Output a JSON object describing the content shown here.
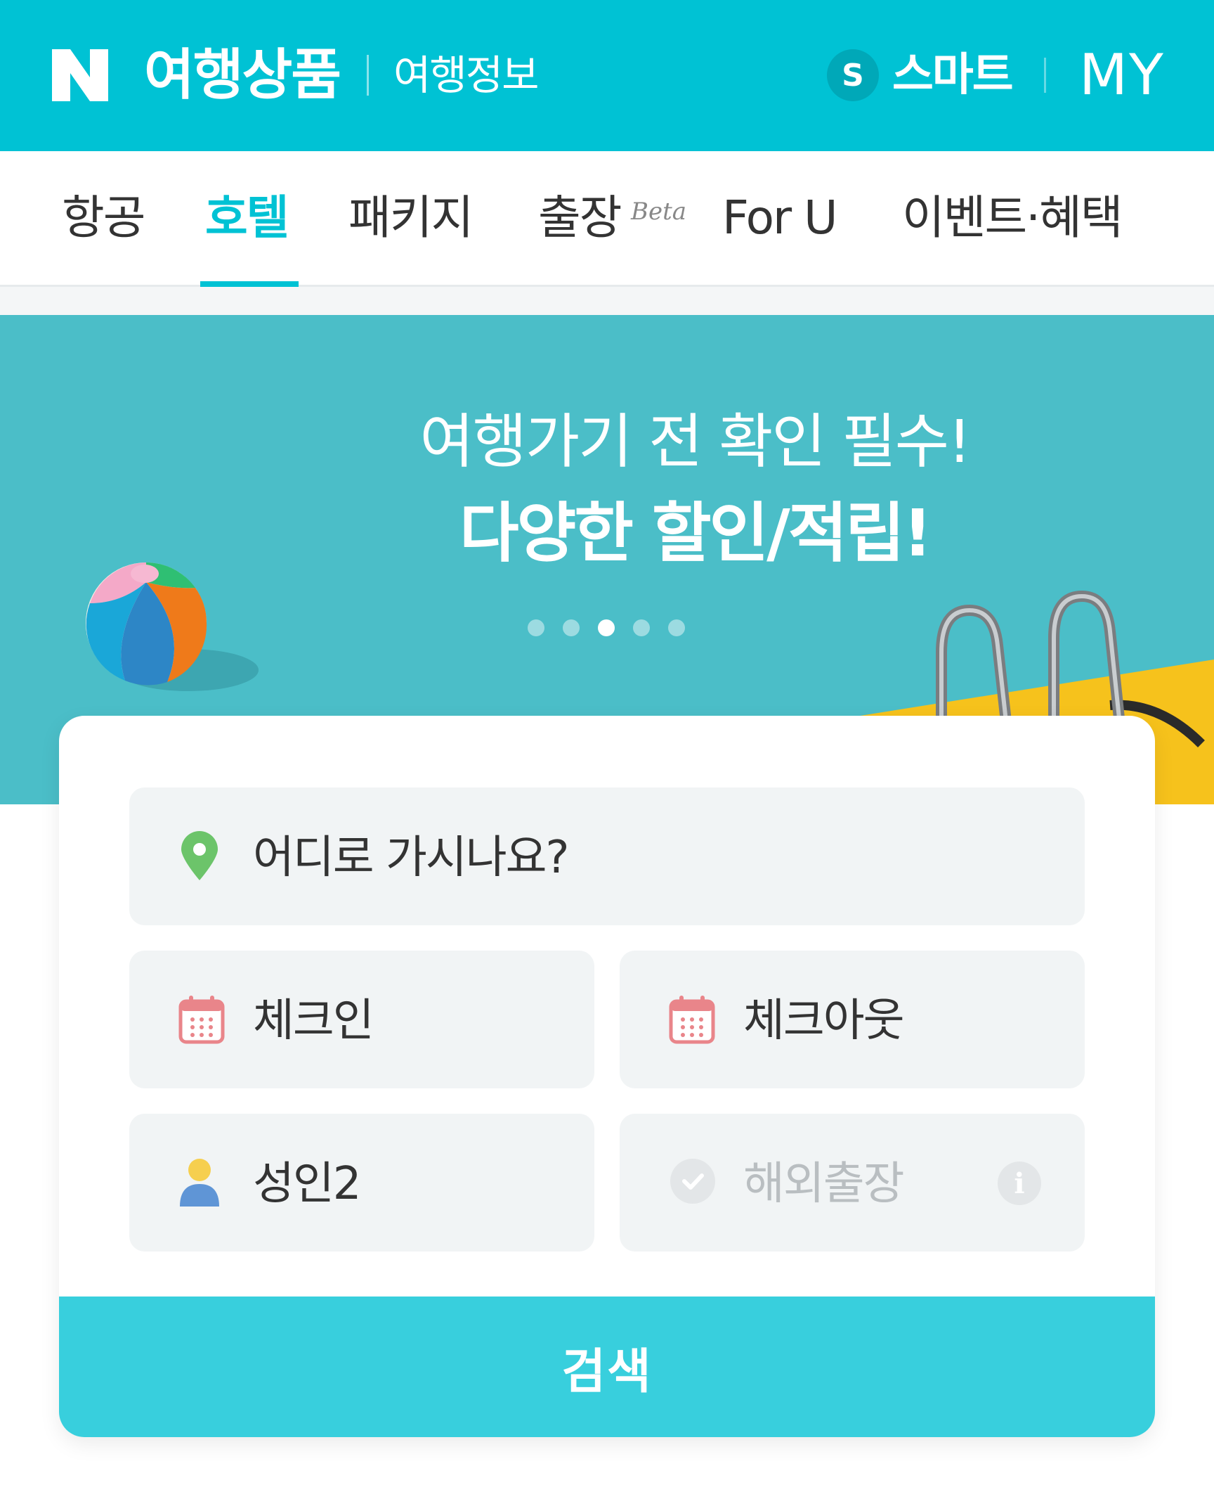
{
  "header": {
    "brand": "여행상품",
    "sub": "여행정보",
    "smart_badge": "S",
    "smart_label": "스마트",
    "my": "MY",
    "color": "#00c2d4"
  },
  "nav": {
    "tabs": [
      {
        "label": "항공"
      },
      {
        "label": "호텔",
        "active": true
      },
      {
        "label": "패키지"
      },
      {
        "label": "출장",
        "badge": "Beta"
      },
      {
        "label": "For U"
      },
      {
        "label": "이벤트·혜택"
      }
    ]
  },
  "banner": {
    "line1": "여행가기 전 확인 필수!",
    "line2": "다양한 할인/적립!",
    "slide_count": 5,
    "active_slide": 3
  },
  "search": {
    "destination_placeholder": "어디로 가시나요?",
    "checkin_label": "체크인",
    "checkout_label": "체크아웃",
    "guests_label": "성인2",
    "business_trip_label": "해외출장",
    "business_trip_checked": false,
    "info_icon": "i",
    "submit_label": "검색"
  }
}
